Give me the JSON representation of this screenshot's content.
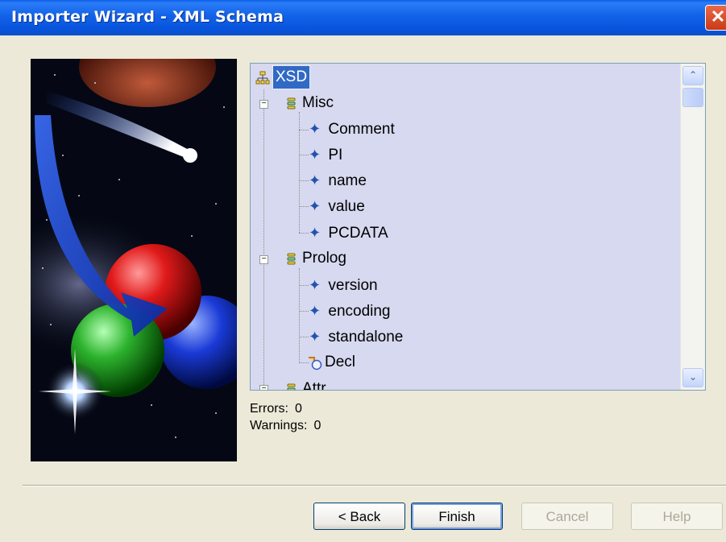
{
  "window": {
    "title": "Importer Wizard - XML Schema",
    "close_glyph": "✕"
  },
  "tree": {
    "root": {
      "label": "XSD",
      "icon": "schema-root-icon"
    },
    "groups": [
      {
        "label": "Misc",
        "expander": "−",
        "children": [
          "Comment",
          "PI",
          "name",
          "value",
          "PCDATA"
        ]
      },
      {
        "label": "Prolog",
        "expander": "−",
        "children": [
          "version",
          "encoding",
          "standalone",
          "Decl"
        ]
      },
      {
        "label": "Attr",
        "expander": "−",
        "children": []
      }
    ]
  },
  "scrollbar": {
    "up_glyph": "⌃",
    "down_glyph": "⌄"
  },
  "status": {
    "errors_label": "Errors:",
    "errors_value": "0",
    "warnings_label": "Warnings:",
    "warnings_value": "0"
  },
  "buttons": {
    "back": "< Back",
    "finish": "Finish",
    "cancel": "Cancel",
    "help": "Help"
  },
  "colors": {
    "titlebar": "#0753db",
    "tree_background": "#d6d9ef",
    "selection": "#316ac5",
    "dialog": "#ece9d8"
  }
}
